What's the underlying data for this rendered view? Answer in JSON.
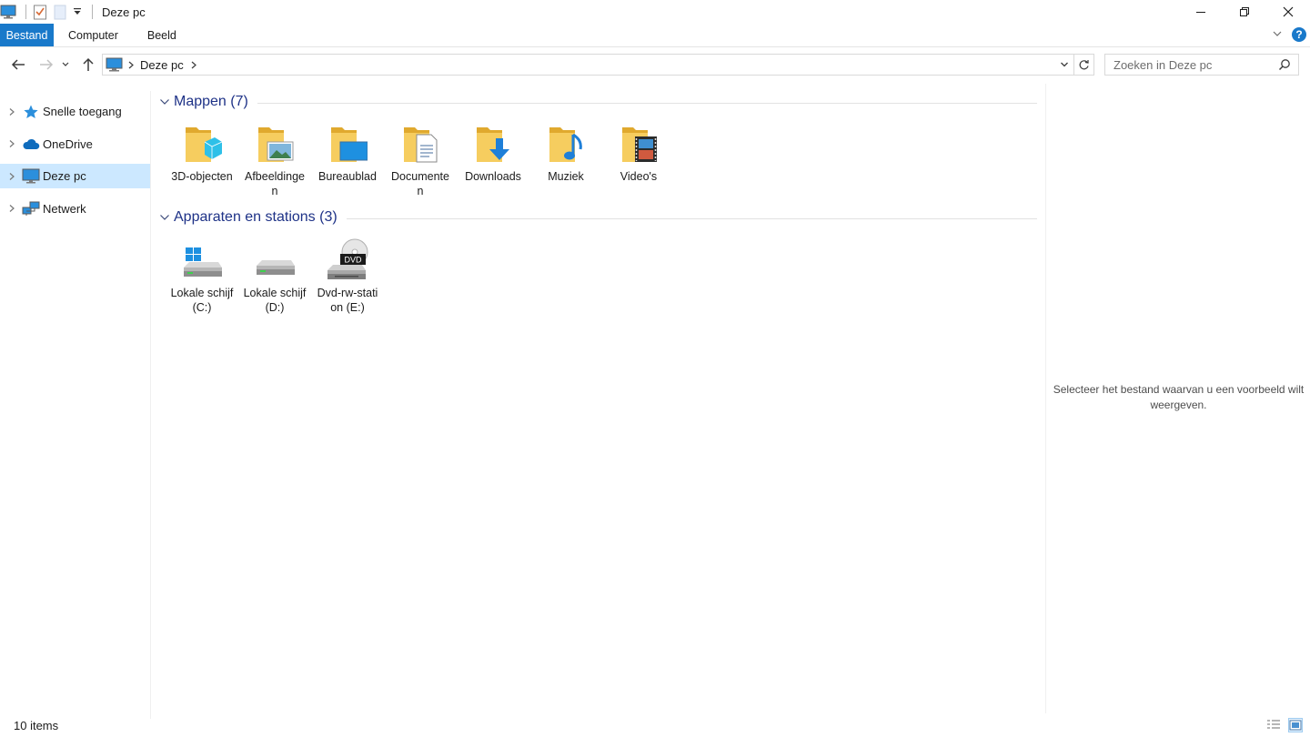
{
  "window": {
    "title": "Deze pc",
    "controls": [
      "minimize",
      "restore",
      "close"
    ]
  },
  "ribbon": {
    "tabs": [
      {
        "label": "Bestand",
        "active": true
      },
      {
        "label": "Computer",
        "active": false
      },
      {
        "label": "Beeld",
        "active": false
      }
    ]
  },
  "address": {
    "crumbs": [
      "Deze pc"
    ],
    "search_placeholder": "Zoeken in Deze pc"
  },
  "navpane": {
    "items": [
      {
        "label": "Snelle toegang",
        "icon": "star-icon",
        "selected": false
      },
      {
        "label": "OneDrive",
        "icon": "cloud-icon",
        "selected": false
      },
      {
        "label": "Deze pc",
        "icon": "computer-icon",
        "selected": true
      },
      {
        "label": "Netwerk",
        "icon": "network-icon",
        "selected": false
      }
    ]
  },
  "groups": {
    "folders": {
      "title": "Mappen (7)",
      "items": [
        {
          "label": "3D-objecten",
          "icon": "3d-objects-folder-icon"
        },
        {
          "label": "Afbeeldingen",
          "icon": "pictures-folder-icon"
        },
        {
          "label": "Bureaublad",
          "icon": "desktop-folder-icon"
        },
        {
          "label": "Documenten",
          "icon": "documents-folder-icon"
        },
        {
          "label": "Downloads",
          "icon": "downloads-folder-icon"
        },
        {
          "label": "Muziek",
          "icon": "music-folder-icon"
        },
        {
          "label": "Video's",
          "icon": "videos-folder-icon"
        }
      ]
    },
    "devices": {
      "title": "Apparaten en stations (3)",
      "items": [
        {
          "label": "Lokale schijf (C:)",
          "icon": "windows-drive-icon"
        },
        {
          "label": "Lokale schijf (D:)",
          "icon": "drive-icon"
        },
        {
          "label": "Dvd-rw-station (E:)",
          "icon": "dvd-drive-icon",
          "badge": "DVD"
        }
      ]
    }
  },
  "preview": {
    "message": "Selecteer het bestand waarvan u een voorbeeld wilt weergeven."
  },
  "status": {
    "count": "10 items"
  },
  "colors": {
    "accent": "#1979ca",
    "selection": "#cce8ff",
    "group_title": "#1e3287",
    "folder": "#f6cd5f"
  }
}
